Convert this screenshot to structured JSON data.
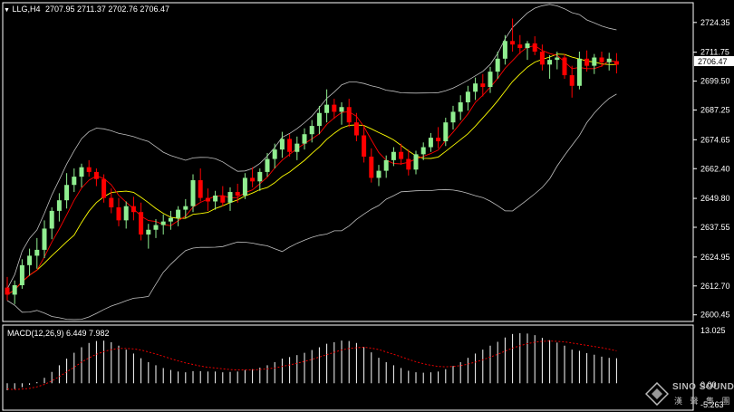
{
  "header": {
    "symbol": "LLG,H4",
    "ohlc": "2707.95 2711.37 2702.76 2706.47"
  },
  "macd": {
    "label": "MACD(12,26,9) 6.449 7.982",
    "axis_top": "13.025",
    "axis_zero": "0.00",
    "axis_bottom": "-5.263"
  },
  "current_price": "2706.47",
  "watermark": {
    "brand": "SINO SOUND",
    "chinese": "漢 聲 集 團"
  },
  "colors": {
    "background": "#000000",
    "bull_candle": "#90ee90",
    "bear_candle": "#ff0000",
    "fast_ma": "#ff0000",
    "slow_ma": "#ffff00",
    "bands": "#c0c0c0",
    "macd_hist": "#ffffff",
    "macd_signal": "#ff0000"
  },
  "chart_data": {
    "type": "candlestick",
    "price_ticks": [
      "2724.35",
      "2711.75",
      "2699.50",
      "2687.25",
      "2674.65",
      "2662.40",
      "2649.80",
      "2637.55",
      "2624.95",
      "2612.70",
      "2600.45"
    ],
    "price_range": [
      2598.8,
      2730.8
    ],
    "candles": [
      [
        2612.0,
        2616.5,
        2606.5,
        2609.0
      ],
      [
        2609.0,
        2615.0,
        2605.0,
        2613.0
      ],
      [
        2613.0,
        2624.0,
        2611.5,
        2621.5
      ],
      [
        2621.5,
        2628.5,
        2617.0,
        2625.5
      ],
      [
        2625.5,
        2633.0,
        2620.0,
        2628.0
      ],
      [
        2628.0,
        2640.5,
        2624.5,
        2637.0
      ],
      [
        2637.0,
        2646.0,
        2632.5,
        2644.5
      ],
      [
        2644.5,
        2652.0,
        2640.0,
        2649.0
      ],
      [
        2649.0,
        2660.5,
        2645.5,
        2655.5
      ],
      [
        2655.5,
        2662.5,
        2652.5,
        2659.0
      ],
      [
        2659.0,
        2664.5,
        2654.5,
        2663.0
      ],
      [
        2663.0,
        2666.0,
        2659.0,
        2661.0
      ],
      [
        2661.0,
        2662.5,
        2655.0,
        2658.0
      ],
      [
        2658.0,
        2660.0,
        2648.0,
        2650.0
      ],
      [
        2650.0,
        2654.0,
        2643.5,
        2646.0
      ],
      [
        2646.0,
        2650.0,
        2638.0,
        2640.5
      ],
      [
        2640.5,
        2648.5,
        2637.0,
        2646.5
      ],
      [
        2646.5,
        2650.5,
        2640.5,
        2644.0
      ],
      [
        2644.0,
        2648.0,
        2632.0,
        2634.5
      ],
      [
        2634.5,
        2639.0,
        2628.5,
        2636.5
      ],
      [
        2636.5,
        2641.0,
        2633.0,
        2638.5
      ],
      [
        2638.5,
        2643.0,
        2634.5,
        2640.0
      ],
      [
        2640.0,
        2644.5,
        2636.5,
        2641.5
      ],
      [
        2641.5,
        2646.5,
        2638.0,
        2645.0
      ],
      [
        2645.0,
        2649.5,
        2641.5,
        2646.5
      ],
      [
        2646.5,
        2660.0,
        2644.0,
        2657.5
      ],
      [
        2657.5,
        2662.5,
        2648.5,
        2650.0
      ],
      [
        2650.0,
        2654.0,
        2644.5,
        2648.5
      ],
      [
        2648.5,
        2653.0,
        2645.0,
        2651.0
      ],
      [
        2651.0,
        2655.0,
        2646.5,
        2648.0
      ],
      [
        2648.0,
        2654.5,
        2644.5,
        2652.5
      ],
      [
        2652.5,
        2656.0,
        2648.0,
        2651.0
      ],
      [
        2651.0,
        2660.5,
        2649.5,
        2658.5
      ],
      [
        2658.5,
        2663.0,
        2654.5,
        2657.0
      ],
      [
        2657.0,
        2662.5,
        2653.0,
        2661.0
      ],
      [
        2661.0,
        2669.0,
        2659.0,
        2666.5
      ],
      [
        2666.5,
        2673.0,
        2662.5,
        2670.5
      ],
      [
        2670.5,
        2678.0,
        2667.0,
        2675.0
      ],
      [
        2675.0,
        2677.0,
        2667.5,
        2669.5
      ],
      [
        2669.5,
        2676.0,
        2666.0,
        2673.0
      ],
      [
        2673.0,
        2679.5,
        2670.5,
        2677.0
      ],
      [
        2677.0,
        2683.0,
        2673.5,
        2680.5
      ],
      [
        2680.5,
        2689.0,
        2677.0,
        2686.0
      ],
      [
        2686.0,
        2696.0,
        2682.0,
        2689.5
      ],
      [
        2689.5,
        2692.0,
        2683.5,
        2686.5
      ],
      [
        2686.5,
        2690.5,
        2681.0,
        2688.5
      ],
      [
        2688.5,
        2692.0,
        2680.0,
        2682.0
      ],
      [
        2682.0,
        2686.0,
        2674.0,
        2676.5
      ],
      [
        2676.5,
        2680.0,
        2665.0,
        2667.5
      ],
      [
        2667.5,
        2671.0,
        2656.5,
        2658.5
      ],
      [
        2658.5,
        2664.0,
        2655.0,
        2661.5
      ],
      [
        2661.5,
        2668.0,
        2658.5,
        2666.0
      ],
      [
        2666.0,
        2671.5,
        2663.5,
        2669.5
      ],
      [
        2669.5,
        2673.0,
        2664.0,
        2666.5
      ],
      [
        2666.5,
        2670.5,
        2659.5,
        2662.0
      ],
      [
        2662.0,
        2670.0,
        2660.0,
        2668.5
      ],
      [
        2668.5,
        2673.5,
        2666.0,
        2671.5
      ],
      [
        2671.5,
        2677.5,
        2669.5,
        2675.5
      ],
      [
        2675.5,
        2680.0,
        2671.0,
        2674.0
      ],
      [
        2674.0,
        2684.0,
        2672.0,
        2682.0
      ],
      [
        2682.0,
        2689.0,
        2679.0,
        2686.5
      ],
      [
        2686.5,
        2693.5,
        2683.0,
        2690.5
      ],
      [
        2690.5,
        2697.5,
        2687.0,
        2695.0
      ],
      [
        2695.0,
        2701.0,
        2691.5,
        2698.5
      ],
      [
        2698.5,
        2702.5,
        2693.0,
        2697.0
      ],
      [
        2697.0,
        2705.5,
        2694.5,
        2703.5
      ],
      [
        2703.5,
        2712.0,
        2700.5,
        2709.0
      ],
      [
        2709.0,
        2719.0,
        2706.5,
        2716.5
      ],
      [
        2716.5,
        2726.0,
        2712.0,
        2715.0
      ],
      [
        2715.0,
        2719.0,
        2711.0,
        2713.5
      ],
      [
        2713.5,
        2716.5,
        2708.5,
        2715.5
      ],
      [
        2715.5,
        2718.5,
        2710.5,
        2712.0
      ],
      [
        2712.0,
        2715.0,
        2704.0,
        2706.5
      ],
      [
        2706.5,
        2710.5,
        2700.5,
        2708.5
      ],
      [
        2708.5,
        2712.0,
        2704.5,
        2709.5
      ],
      [
        2709.5,
        2711.0,
        2700.5,
        2702.0
      ],
      [
        2702.0,
        2706.0,
        2692.5,
        2697.5
      ],
      [
        2697.5,
        2712.0,
        2696.0,
        2709.0
      ],
      [
        2709.0,
        2712.5,
        2703.5,
        2706.0
      ],
      [
        2706.0,
        2711.0,
        2702.5,
        2709.5
      ],
      [
        2709.5,
        2712.0,
        2705.5,
        2707.5
      ],
      [
        2707.5,
        2711.5,
        2704.0,
        2709.0
      ],
      [
        2707.95,
        2711.37,
        2702.76,
        2706.47
      ]
    ],
    "macd_range": [
      -5.263,
      13.025
    ],
    "macd_hist": [
      -1.8,
      -1.5,
      -1.0,
      -0.4,
      0.3,
      1.4,
      2.9,
      4.6,
      6.3,
      7.8,
      9.2,
      10.3,
      10.8,
      10.9,
      10.5,
      9.6,
      8.6,
      7.6,
      6.4,
      5.4,
      4.6,
      3.9,
      3.4,
      3.0,
      2.8,
      3.1,
      3.1,
      3.0,
      3.0,
      2.8,
      2.9,
      3.0,
      3.4,
      3.6,
      4.0,
      4.6,
      5.4,
      6.3,
      6.7,
      7.2,
      7.8,
      8.5,
      9.2,
      10.1,
      10.5,
      10.9,
      10.8,
      10.3,
      9.3,
      7.9,
      6.5,
      5.4,
      4.6,
      3.9,
      3.2,
      2.8,
      2.7,
      2.8,
      3.0,
      3.6,
      4.4,
      5.4,
      6.5,
      7.6,
      8.6,
      9.6,
      10.6,
      11.7,
      12.6,
      12.8,
      12.7,
      12.3,
      11.6,
      11.0,
      10.4,
      9.6,
      8.6,
      8.3,
      7.7,
      7.3,
      6.8,
      6.5,
      6.4
    ],
    "macd_signal": [
      -1.5,
      -1.6,
      -1.5,
      -1.3,
      -0.9,
      -0.3,
      0.6,
      1.7,
      2.9,
      4.1,
      5.4,
      6.5,
      7.4,
      8.1,
      8.6,
      8.9,
      8.9,
      8.8,
      8.5,
      8.0,
      7.5,
      6.9,
      6.3,
      5.7,
      5.2,
      4.8,
      4.4,
      4.1,
      3.9,
      3.7,
      3.5,
      3.4,
      3.4,
      3.4,
      3.5,
      3.7,
      3.9,
      4.3,
      4.7,
      5.1,
      5.6,
      6.1,
      6.7,
      7.3,
      7.9,
      8.5,
      8.9,
      9.1,
      9.2,
      9.0,
      8.6,
      8.0,
      7.4,
      6.8,
      6.1,
      5.5,
      5.0,
      4.6,
      4.3,
      4.2,
      4.3,
      4.5,
      4.9,
      5.4,
      6.0,
      6.7,
      7.4,
      8.2,
      9.0,
      9.6,
      10.1,
      10.5,
      10.7,
      10.8,
      10.7,
      10.6,
      10.3,
      10.0,
      9.7,
      9.4,
      9.1,
      8.7,
      8.3
    ]
  }
}
